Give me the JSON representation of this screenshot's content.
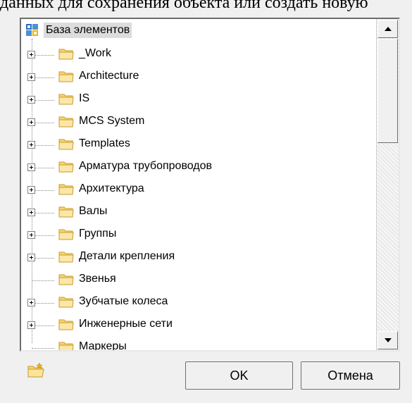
{
  "header": {
    "partial_text": "данных для сохранения объекта или создать новую"
  },
  "tree": {
    "root": {
      "label": "База элементов",
      "icon": "database-icon"
    },
    "items": [
      {
        "label": "_Work",
        "icon": "folder-icon",
        "expandable": true
      },
      {
        "label": "Architecture",
        "icon": "folder-icon",
        "expandable": true
      },
      {
        "label": "IS",
        "icon": "folder-icon",
        "expandable": true
      },
      {
        "label": "MCS System",
        "icon": "folder-icon",
        "expandable": true
      },
      {
        "label": "Templates",
        "icon": "folder-icon",
        "expandable": true
      },
      {
        "label": "Арматура трубопроводов",
        "icon": "folder-icon",
        "expandable": true
      },
      {
        "label": "Архитектура",
        "icon": "folder-icon",
        "expandable": true
      },
      {
        "label": "Валы",
        "icon": "folder-icon",
        "expandable": true
      },
      {
        "label": "Группы",
        "icon": "folder-icon",
        "expandable": true
      },
      {
        "label": "Детали крепления",
        "icon": "folder-icon",
        "expandable": true
      },
      {
        "label": "Звенья",
        "icon": "folder-icon",
        "expandable": false
      },
      {
        "label": "Зубчатые колеса",
        "icon": "folder-icon",
        "expandable": true
      },
      {
        "label": "Инженерные сети",
        "icon": "folder-icon",
        "expandable": true
      },
      {
        "label": "Маркеры",
        "icon": "folder-icon",
        "expandable": false
      }
    ]
  },
  "buttons": {
    "ok_label": "OK",
    "cancel_label": "Отмена",
    "new_folder_icon": "new-folder-icon"
  },
  "colors": {
    "folder_fill": "#f8d66c",
    "folder_stroke": "#c99a2e",
    "selection": "#dcdcdc"
  }
}
